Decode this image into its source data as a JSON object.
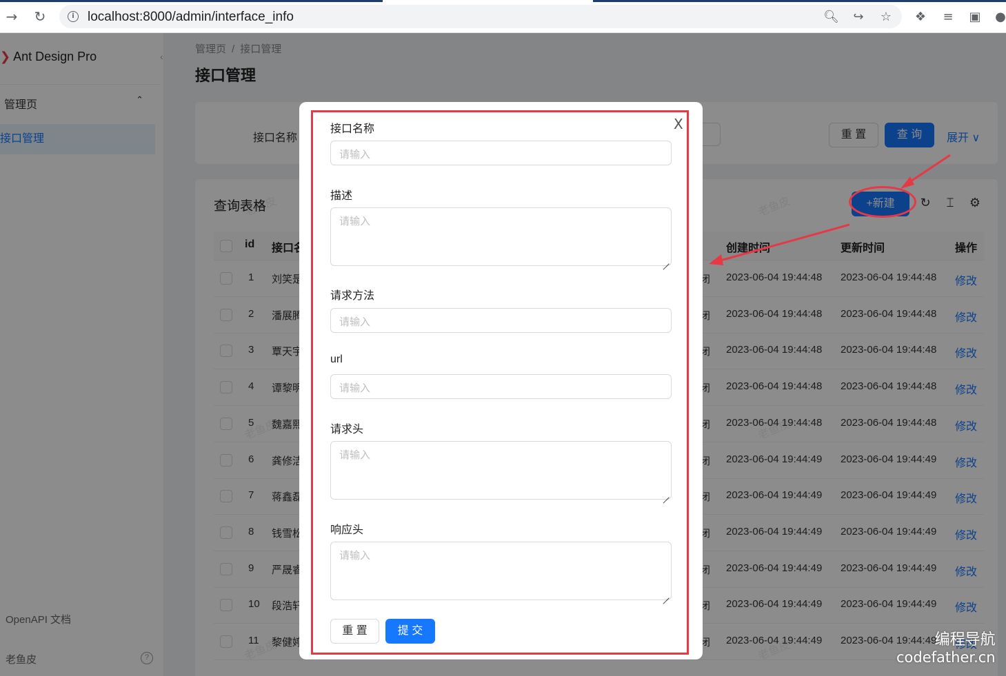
{
  "browser": {
    "url": "localhost:8000/admin/interface_info",
    "back_icon": "→",
    "reload_icon": "↻",
    "info_icon": "i"
  },
  "sidebar": {
    "brand": "Ant Design Pro",
    "brand_mark": "❯",
    "collapse_icon": "‹",
    "group_label": "管理页",
    "group_chevron": "⌃",
    "active_item": "接口管理",
    "footer_link": "OpenAPI 文档",
    "user_name": "老鱼皮",
    "help_icon": "?"
  },
  "page": {
    "breadcrumb": [
      "管理页",
      "接口管理"
    ],
    "breadcrumb_sep": "/",
    "title": "接口管理"
  },
  "search": {
    "field_label": "接口名称",
    "reset_label": "重 置",
    "query_label": "查 询",
    "expand_label": "展开 ∨"
  },
  "table": {
    "title": "查询表格",
    "new_label": "+新建",
    "columns": [
      "id",
      "接口名",
      "创建时间",
      "更新时间",
      "操作"
    ],
    "rows": [
      {
        "id": "1",
        "name": "刘笑是",
        "status": "闭",
        "created": "2023-06-04 19:44:48",
        "updated": "2023-06-04 19:44:48",
        "action": "修改"
      },
      {
        "id": "2",
        "name": "潘展腾",
        "status": "闭",
        "created": "2023-06-04 19:44:48",
        "updated": "2023-06-04 19:44:48",
        "action": "修改"
      },
      {
        "id": "3",
        "name": "覃天宇",
        "status": "闭",
        "created": "2023-06-04 19:44:48",
        "updated": "2023-06-04 19:44:48",
        "action": "修改"
      },
      {
        "id": "4",
        "name": "谭黎明",
        "status": "闭",
        "created": "2023-06-04 19:44:48",
        "updated": "2023-06-04 19:44:48",
        "action": "修改"
      },
      {
        "id": "5",
        "name": "魏嘉熙",
        "status": "闭",
        "created": "2023-06-04 19:44:48",
        "updated": "2023-06-04 19:44:48",
        "action": "修改"
      },
      {
        "id": "6",
        "name": "龚修洁",
        "status": "闭",
        "created": "2023-06-04 19:44:49",
        "updated": "2023-06-04 19:44:49",
        "action": "修改"
      },
      {
        "id": "7",
        "name": "蒋鑫磊",
        "status": "闭",
        "created": "2023-06-04 19:44:49",
        "updated": "2023-06-04 19:44:49",
        "action": "修改"
      },
      {
        "id": "8",
        "name": "钱雪松",
        "status": "闭",
        "created": "2023-06-04 19:44:49",
        "updated": "2023-06-04 19:44:49",
        "action": "修改"
      },
      {
        "id": "9",
        "name": "严晟睿",
        "status": "闭",
        "created": "2023-06-04 19:44:49",
        "updated": "2023-06-04 19:44:49",
        "action": "修改"
      },
      {
        "id": "10",
        "name": "段浩轩",
        "status": "闭",
        "created": "2023-06-04 19:44:49",
        "updated": "2023-06-04 19:44:49",
        "action": "修改"
      },
      {
        "id": "11",
        "name": "黎健婷",
        "status": "闭",
        "created": "2023-06-04 19:44:49",
        "updated": "2023-06-04 19:44:49",
        "action": "修改"
      }
    ]
  },
  "watermark_text": "老鱼皮",
  "modal": {
    "close_icon": "X",
    "placeholder": "请输入",
    "fields": [
      {
        "label": "接口名称",
        "type": "input"
      },
      {
        "label": "描述",
        "type": "textarea"
      },
      {
        "label": "请求方法",
        "type": "input"
      },
      {
        "label": "url",
        "type": "input"
      },
      {
        "label": "请求头",
        "type": "textarea"
      },
      {
        "label": "响应头",
        "type": "textarea"
      }
    ],
    "reset_label": "重 置",
    "submit_label": "提 交"
  },
  "brand_watermark": {
    "line1": "编程导航",
    "line2": "codefather.cn"
  },
  "colors": {
    "primary": "#1677ff",
    "annotation": "#e63946"
  }
}
